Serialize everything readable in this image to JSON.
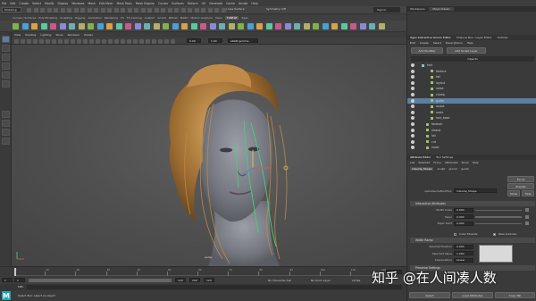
{
  "menubar": {
    "items": [
      "File",
      "Edit",
      "Create",
      "Select",
      "Modify",
      "Display",
      "Windows",
      "Mesh",
      "Edit Mesh",
      "Mesh Tools",
      "Mesh Display",
      "Curves",
      "Surfaces",
      "Deform",
      "UV",
      "Generate",
      "Cache",
      "Arnold",
      "Help"
    ],
    "workspace_label": "Workspace:",
    "workspace_value": "Maya Classic"
  },
  "shelf": {
    "mode_value": "Modeling",
    "live_surface": "No Live Surface",
    "symmetry": "Symmetry: Off",
    "sign_in": "Sign In",
    "tabs": [
      "Curves / Surfaces",
      "Poly Modeling",
      "Sculpting",
      "Rigging",
      "Animation",
      "Rendering",
      "FX",
      "FX Caching",
      "Custom",
      "Arnold",
      "Bifrost",
      "MASH",
      "Motion Graphics",
      "XGen",
      "TURTLE",
      "Xgen"
    ]
  },
  "panel_menu": [
    "View",
    "Shading",
    "Lighting",
    "Show",
    "Renderer",
    "Panels"
  ],
  "viewport": {
    "field1": "0.00",
    "field2": "1.00",
    "colorspace": "sRGB gamma",
    "persp_label": "persp"
  },
  "outliner": {
    "title": "Xgen Interactive Groom Editor",
    "tabs": [
      "Xgen Interactive Groom Editor",
      "Channel Box / Layer Editor",
      "Outliner"
    ],
    "menu": [
      "Edit",
      "Create",
      "Select",
      "Descriptions",
      "Help"
    ],
    "add_modifier": "Add Modifier",
    "add_sculpt_layer": "Add Sculpt Layer",
    "column_header": "Objects",
    "items": [
      {
        "label": "hair",
        "indent": 0,
        "selected": false
      },
      {
        "label": "texture",
        "indent": 2,
        "selected": false
      },
      {
        "label": "tail",
        "indent": 2,
        "selected": false
      },
      {
        "label": "layout",
        "indent": 2,
        "selected": false
      },
      {
        "label": "noise",
        "indent": 2,
        "selected": false
      },
      {
        "label": "clump",
        "indent": 2,
        "selected": false
      },
      {
        "label": "guide",
        "indent": 2,
        "selected": true
      },
      {
        "label": "sculpt",
        "indent": 2,
        "selected": false
      },
      {
        "label": "scale",
        "indent": 2,
        "selected": false
      },
      {
        "label": "hair_base",
        "indent": 2,
        "selected": false
      },
      {
        "label": "forehair",
        "indent": 1,
        "selected": false
      },
      {
        "label": "strand",
        "indent": 1,
        "selected": false
      },
      {
        "label": "tail",
        "indent": 1,
        "selected": false
      },
      {
        "label": "cut",
        "indent": 1,
        "selected": false
      },
      {
        "label": "noise",
        "indent": 1,
        "selected": false
      }
    ]
  },
  "attribute_editor": {
    "title": "Attribute Editor",
    "tab2": "Tool Settings",
    "menu": [
      "List",
      "Selected",
      "Focus",
      "Attributes",
      "Show",
      "Help"
    ],
    "node_tabs": [
      "inGuide_Shape",
      "sculpt",
      "groom",
      "guide"
    ],
    "node_label": "splineGuideModifier:",
    "node_value": "inGuide_Shape",
    "focus_btn": "Focus",
    "presets_btn": "Presets",
    "show_btn": "Show",
    "hide_btn": "Hide",
    "section1": "Interactive Attributes",
    "attrs": [
      {
        "label": "Width Scale",
        "value": "0.000"
      },
      {
        "label": "Taper",
        "value": "0.000"
      },
      {
        "label": "Taper Start",
        "value": "0.000"
      }
    ],
    "cb_label": "Color Strands",
    "cb_label2": "Pass Controls",
    "section2": "Width Ramp",
    "ramp_attrs": [
      {
        "label": "Selected Position",
        "value": "0.000"
      },
      {
        "label": "Selected Value",
        "value": "1.000"
      },
      {
        "label": "Interpolation",
        "value": "Linear"
      }
    ],
    "section3": "Preserve Settings",
    "select_btn": "Select",
    "load_btn": "Load Attributes",
    "copy_btn": "Copy Tab"
  },
  "timeline": {
    "ticks": [
      "1",
      "10",
      "20",
      "30",
      "40",
      "50",
      "60",
      "70",
      "80",
      "90",
      "100",
      "110",
      "120"
    ],
    "current": "1"
  },
  "range": {
    "start": "1",
    "start2": "1",
    "end": "120",
    "end2": "200",
    "end3": "120",
    "character": "No Character Set",
    "anim_layer": "No Anim Layer",
    "fps": "24 fps"
  },
  "cmd": {
    "label": "MEL"
  },
  "help": {
    "text": "Select Tool: select an object"
  },
  "watermark": "知乎 @在人间凑人数",
  "colors": {
    "accent": "#5a7fa0",
    "hair": "#c28a45",
    "guide": "#46d07a",
    "manipulator_y": "#d6c34a",
    "manipulator_x": "#d65a4a"
  }
}
